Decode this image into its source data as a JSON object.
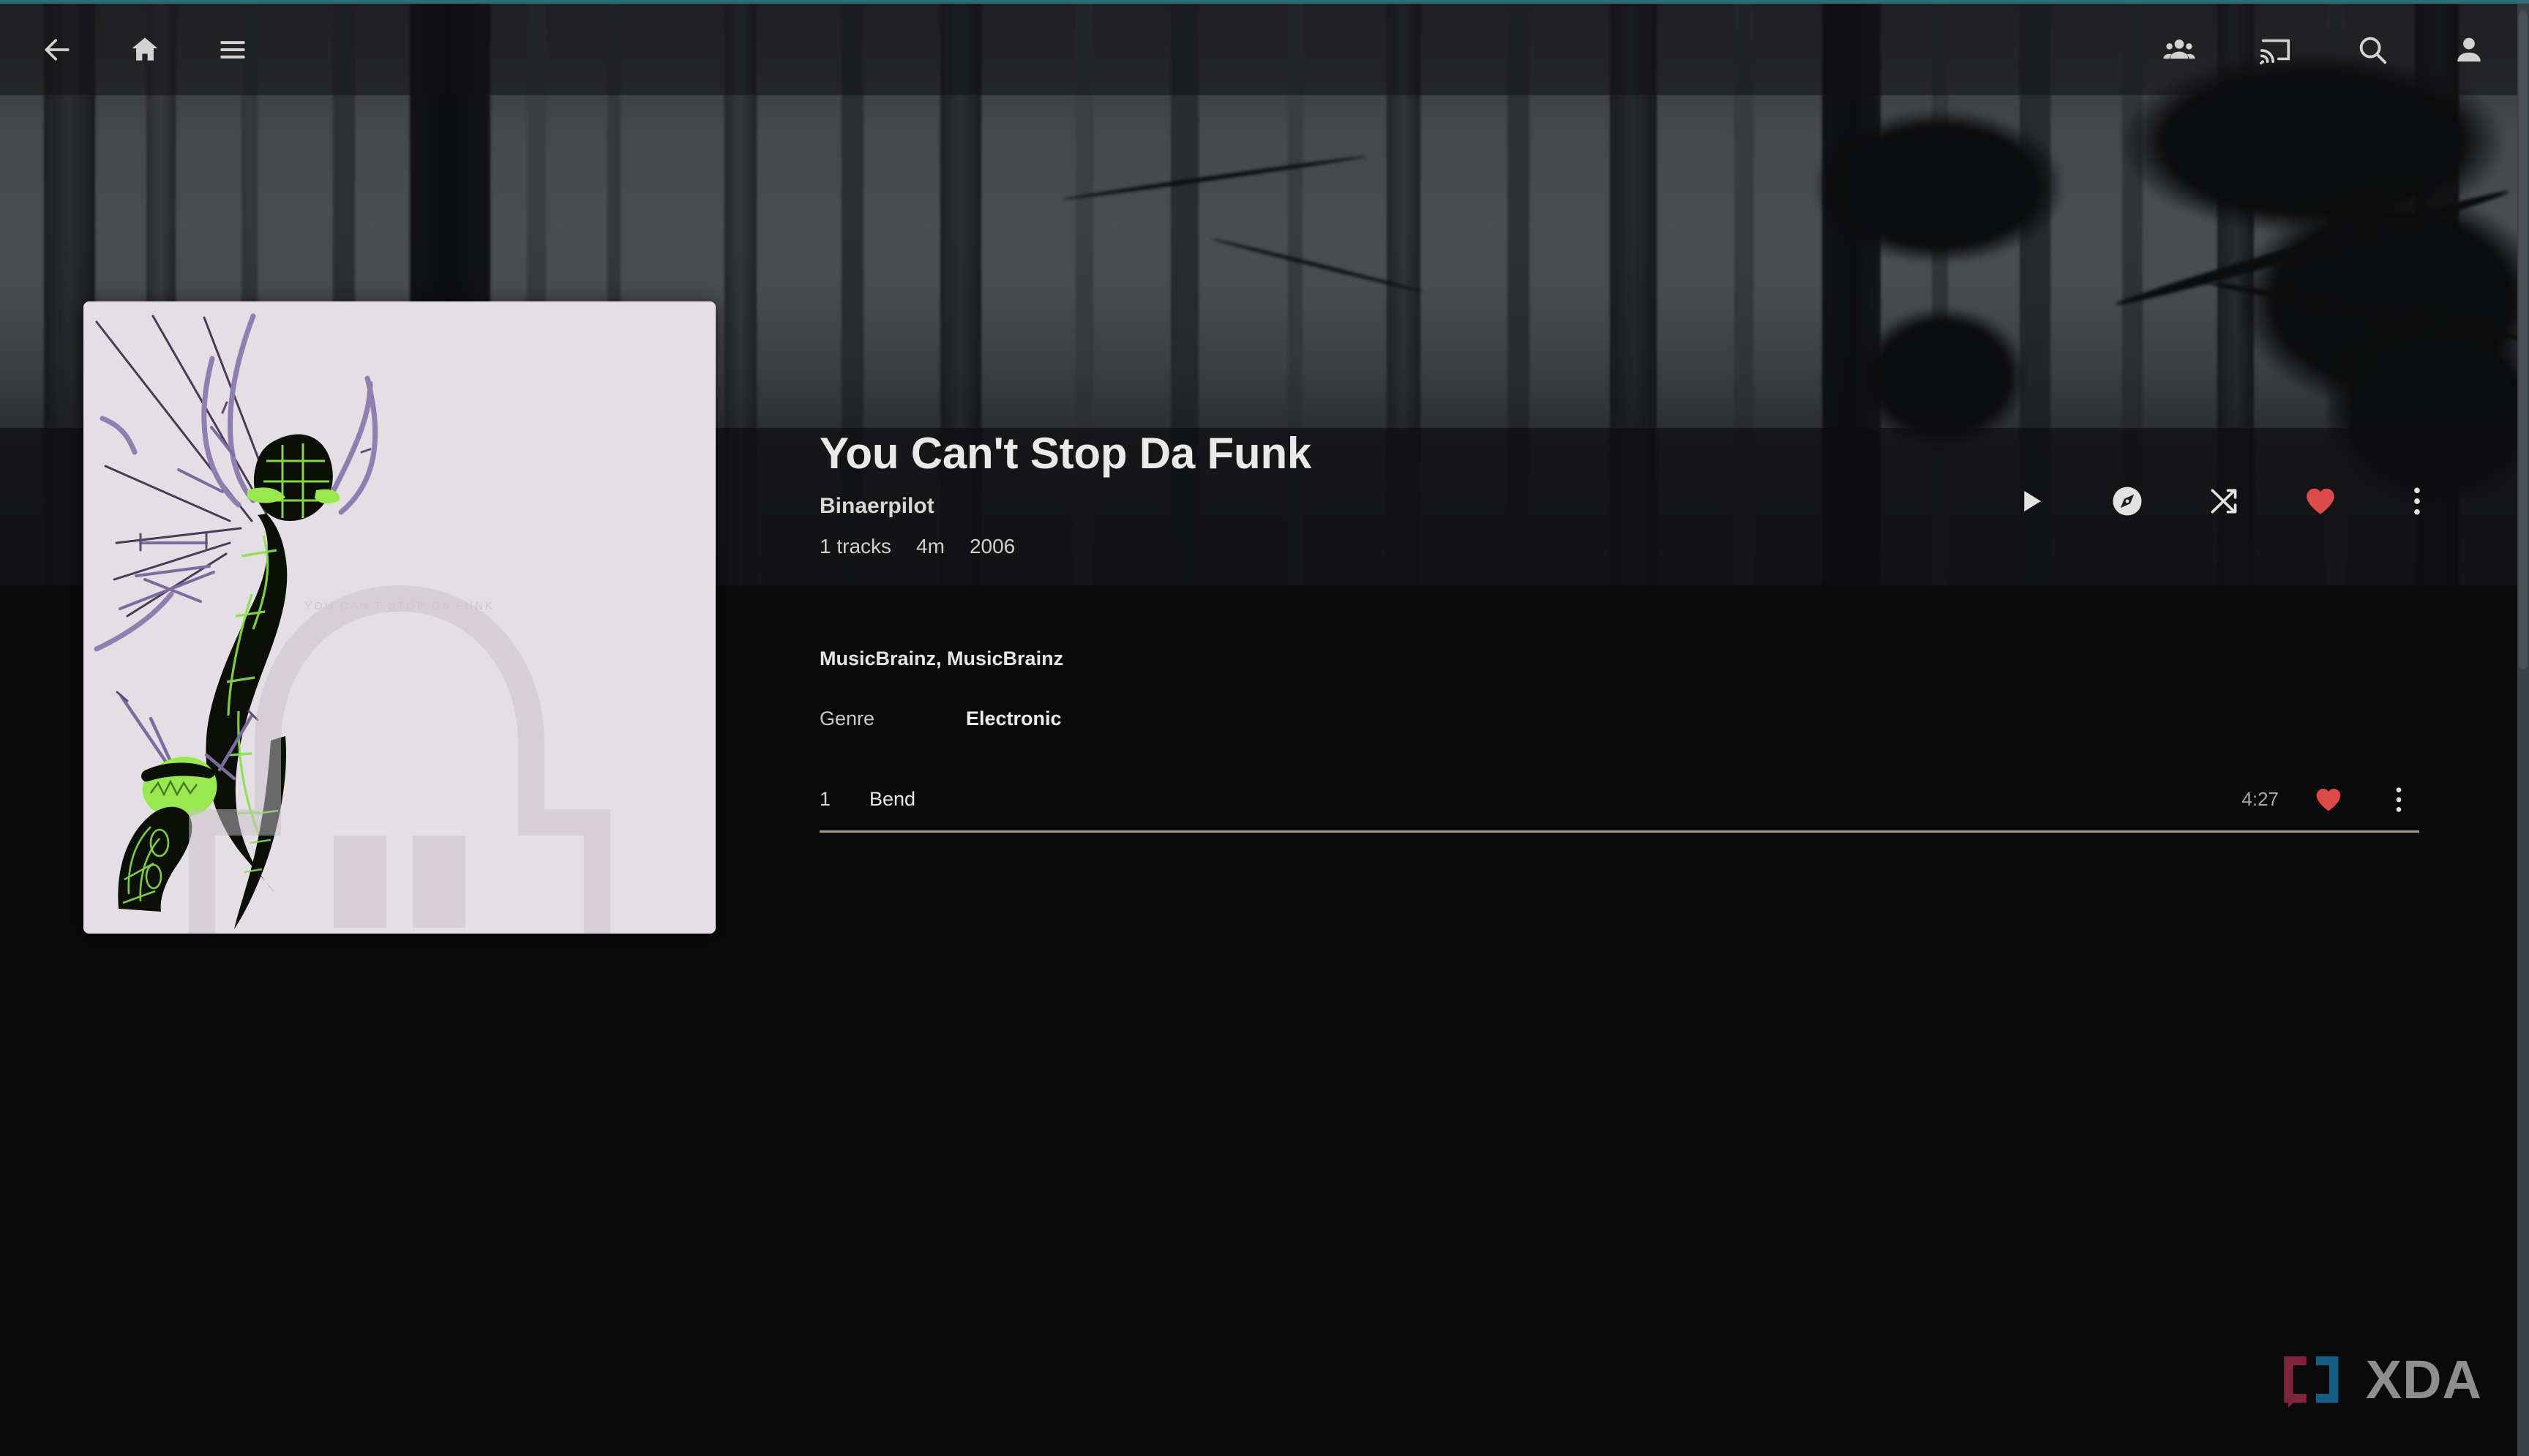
{
  "accent": {
    "teal": "#2c6e74",
    "heart_red": "#dc4a4a",
    "divider": "#a79c8e"
  },
  "appbar": {
    "left_items": [
      {
        "name": "back-icon",
        "label": "Back"
      },
      {
        "name": "home-icon",
        "label": "Home"
      },
      {
        "name": "menu-icon",
        "label": "Menu"
      }
    ],
    "right_items": [
      {
        "name": "users-icon",
        "label": "Users"
      },
      {
        "name": "cast-icon",
        "label": "Cast"
      },
      {
        "name": "search-icon",
        "label": "Search"
      },
      {
        "name": "account-icon",
        "label": "Account"
      }
    ]
  },
  "album": {
    "title": "You Can't Stop Da Funk",
    "artist": "Binaerpilot",
    "track_count": "1 tracks",
    "duration": "4m",
    "year": "2006",
    "art_watermark": "YOU CAN'T STOP DA FUNK",
    "art_bg": "#e4dfe4"
  },
  "hero_actions": [
    {
      "name": "play-button",
      "label": "Play"
    },
    {
      "name": "explore-button",
      "label": "Explore"
    },
    {
      "name": "shuffle-button",
      "label": "Shuffle"
    },
    {
      "name": "favorite-button",
      "label": "Favorite"
    },
    {
      "name": "more-options-button",
      "label": "More"
    }
  ],
  "details": {
    "credits": "MusicBrainz, MusicBrainz",
    "genre_label": "Genre",
    "genre_value": "Electronic"
  },
  "tracks": [
    {
      "index": "1",
      "title": "Bend",
      "duration": "4:27",
      "favorited": true
    }
  ],
  "watermark": {
    "text": "XDA"
  }
}
